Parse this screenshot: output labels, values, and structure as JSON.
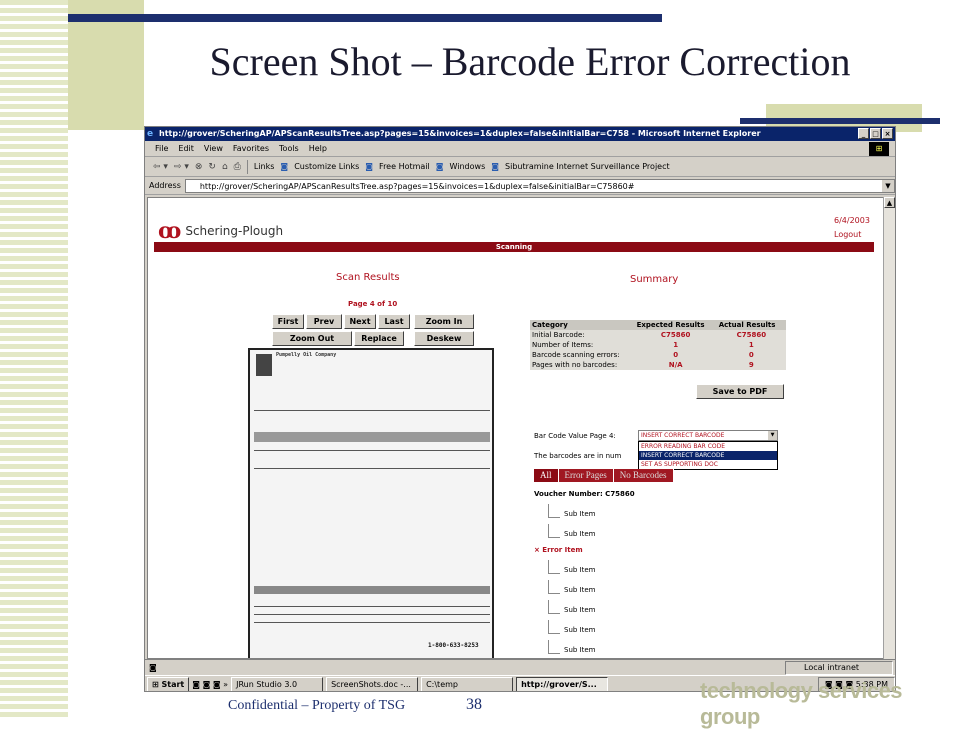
{
  "slide": {
    "title": "Screen Shot – Barcode Error Correction",
    "footer_confidential": "Confidential – Property of TSG",
    "footer_page": "38",
    "footer_brand": "technology services group"
  },
  "browser": {
    "window_title": "http://grover/ScheringAP/APScanResultsTree.asp?pages=15&invoices=1&duplex=false&initialBar=C758 - Microsoft Internet Explorer",
    "menu": [
      "File",
      "Edit",
      "View",
      "Favorites",
      "Tools",
      "Help"
    ],
    "links_label": "Links",
    "links": [
      "Customize Links",
      "Free Hotmail",
      "Windows",
      "Sibutramine Internet Surveillance Project"
    ],
    "address_label": "Address",
    "address": "http://grover/ScheringAP/APScanResultsTree.asp?pages=15&invoices=1&duplex=false&initialBar=C75860#",
    "status_zone": "Local intranet"
  },
  "taskbar": {
    "start": "Start",
    "tasks": [
      "JRun Studio 3.0",
      "ScreenShots.doc -...",
      "C:\\temp",
      "http://grover/S..."
    ],
    "time": "5:38 PM"
  },
  "page": {
    "brand": "Schering-Plough",
    "date": "6/4/2003",
    "logout": "Logout",
    "section": "Scanning",
    "scan_results_title": "Scan Results",
    "summary_title": "Summary",
    "page_indicator": "Page 4 of 10",
    "nav_buttons": [
      "First",
      "Prev",
      "Next",
      "Last",
      "Zoom In"
    ],
    "action_buttons": [
      "Zoom Out",
      "Replace",
      "Deskew"
    ],
    "save_pdf": "Save to PDF",
    "invoice_company": "Pumpelly Oil Company",
    "invoice_footer_phone": "1-800-633-8253",
    "summary_table": {
      "headers": [
        "Category",
        "Expected Results",
        "Actual Results"
      ],
      "rows": [
        [
          "Initial Barcode:",
          "C75860",
          "C75860"
        ],
        [
          "Number of Items:",
          "1",
          "1"
        ],
        [
          "Barcode scanning errors:",
          "0",
          "0"
        ],
        [
          "Pages with no barcodes:",
          "N/A",
          "9"
        ]
      ]
    },
    "barcode_value_label": "Bar Code Value Page  4:",
    "barcode_selected": "INSERT CORRECT BARCODE",
    "barcode_options": [
      "ERROR READING BAR CODE",
      "INSERT CORRECT BARCODE",
      "SET AS SUPPORTING DOC"
    ],
    "barcodes_text": "The barcodes are in num",
    "tabs": [
      "All",
      "Error Pages",
      "No Barcodes"
    ],
    "voucher": "Voucher Number: C75860",
    "tree_items": [
      "Sub Item",
      "Sub Item",
      "× Error Item",
      "Sub Item",
      "Sub Item",
      "Sub Item",
      "Sub Item",
      "Sub Item"
    ]
  }
}
